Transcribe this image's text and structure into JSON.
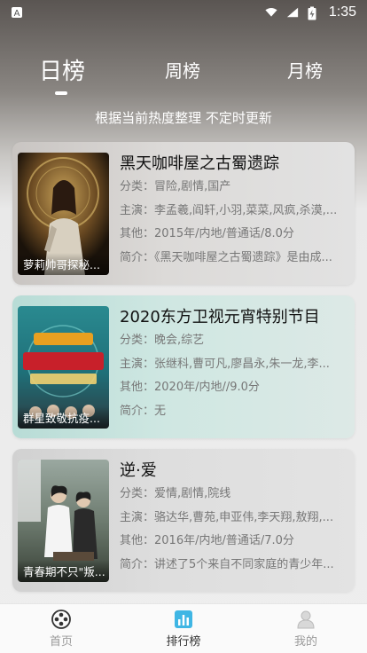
{
  "status_bar": {
    "time": "1:35"
  },
  "tabs": {
    "items": [
      {
        "label": "日榜",
        "active": true
      },
      {
        "label": "周榜",
        "active": false
      },
      {
        "label": "月榜",
        "active": false
      }
    ]
  },
  "subtitle": "根据当前热度整理 不定时更新",
  "cards": [
    {
      "title": "黑天咖啡屋之古蜀遗踪",
      "poster_caption": "萝莉帅哥探秘...",
      "genre_label": "分类：",
      "genre": "冒险,剧情,国产",
      "cast_label": "主演：",
      "cast": "李孟羲,阎轩,小羽,菜菜,风疯,杀漠,...",
      "other_label": "其他：",
      "other": "2015年/内地/普通话/8.0分",
      "summary_label": "简介：",
      "summary": "《黑天咖啡屋之古蜀遗踪》是由成..."
    },
    {
      "title": "2020东方卫视元宵特别节目",
      "poster_caption": "群星致敬抗疫...",
      "genre_label": "分类：",
      "genre": "晚会,综艺",
      "cast_label": "主演：",
      "cast": "张继科,曹可凡,廖昌永,朱一龙,李...",
      "other_label": "其他：",
      "other": "2020年/内地//9.0分",
      "summary_label": "简介：",
      "summary": "无"
    },
    {
      "title": "逆·爱",
      "poster_caption": "青春期不只\"叛...",
      "genre_label": "分类：",
      "genre": "爱情,剧情,院线",
      "cast_label": "主演：",
      "cast": "骆达华,曹苑,申亚伟,李天翔,敖翔,...",
      "other_label": "其他：",
      "other": "2016年/内地/普通话/7.0分",
      "summary_label": "简介：",
      "summary": "讲述了5个来自不同家庭的青少年..."
    }
  ],
  "bottom_nav": {
    "items": [
      {
        "label": "首页",
        "icon": "film-reel-icon",
        "active": false
      },
      {
        "label": "排行榜",
        "icon": "chart-icon",
        "active": true
      },
      {
        "label": "我的",
        "icon": "user-icon",
        "active": false
      }
    ]
  }
}
